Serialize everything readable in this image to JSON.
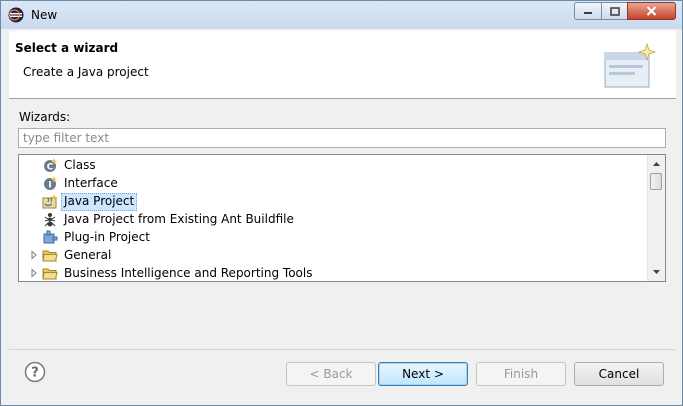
{
  "window": {
    "title": "New",
    "icon": "eclipse-icon"
  },
  "header": {
    "title": "Select a wizard",
    "description": "Create a Java project",
    "banner_icon": "new-wizard-banner-icon"
  },
  "wizards": {
    "label": "Wizards:",
    "filter_placeholder": "type filter text",
    "filter_value": "",
    "items": [
      {
        "label": "Class",
        "icon": "java-class-icon",
        "expandable": false,
        "selected": false
      },
      {
        "label": "Interface",
        "icon": "java-interface-icon",
        "expandable": false,
        "selected": false
      },
      {
        "label": "Java Project",
        "icon": "java-project-icon",
        "expandable": false,
        "selected": true
      },
      {
        "label": "Java Project from Existing Ant Buildfile",
        "icon": "ant-icon",
        "expandable": false,
        "selected": false
      },
      {
        "label": "Plug-in Project",
        "icon": "plugin-project-icon",
        "expandable": false,
        "selected": false
      },
      {
        "label": "General",
        "icon": "folder-icon",
        "expandable": true,
        "selected": false
      },
      {
        "label": "Business Intelligence and Reporting Tools",
        "icon": "folder-icon",
        "expandable": true,
        "selected": false
      }
    ]
  },
  "buttons": {
    "back": "< Back",
    "next": "Next >",
    "finish": "Finish",
    "cancel": "Cancel"
  },
  "colors": {
    "selection": "#cce8ff",
    "default_button_border": "#3c7fb1",
    "close_button": "#c7432a"
  }
}
